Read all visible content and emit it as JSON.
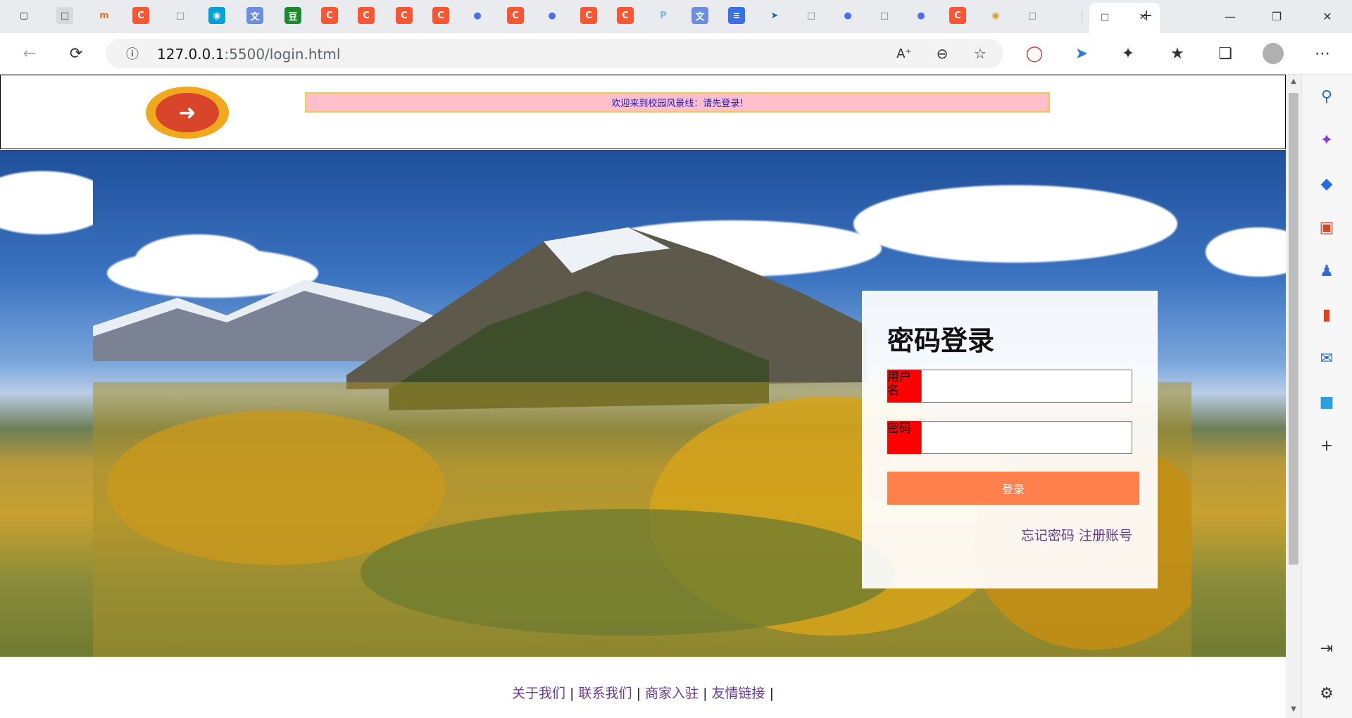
{
  "browser": {
    "url_host": "127.0.0.1",
    "url_rest": ":5500/login.html",
    "tab_icons": [
      "window-icon",
      "page-icon",
      "mail-icon",
      "csdn-icon",
      "page-icon",
      "bilibili-icon",
      "translate-icon",
      "douban-icon",
      "csdn-icon",
      "csdn-icon",
      "csdn-icon",
      "csdn-icon",
      "baidu-icon",
      "csdn-icon",
      "baidu-icon",
      "csdn-icon",
      "csdn-icon",
      "p-icon",
      "translate-icon",
      "docs-icon",
      "bird-icon",
      "page-icon",
      "baidu-icon",
      "page-icon",
      "baidu-icon",
      "csdn-icon",
      "chrome-icon",
      "page-icon",
      "page-icon"
    ]
  },
  "header": {
    "banner_text": "欢迎来到校园风景线：请先登录!"
  },
  "login": {
    "title": "密码登录",
    "username_label": "用户名",
    "password_label": "密码",
    "submit_label": "登录",
    "forgot_label": "忘记密码",
    "register_label": "注册账号"
  },
  "footer": {
    "links": [
      "关于我们",
      "联系我们",
      "商家入驻",
      "友情链接"
    ],
    "separator": "|"
  },
  "colors": {
    "banner_bg": "#ffc0cb",
    "label_bg": "#ff0000",
    "button_bg": "#ff7f4d",
    "link": "#6a3a9a"
  }
}
